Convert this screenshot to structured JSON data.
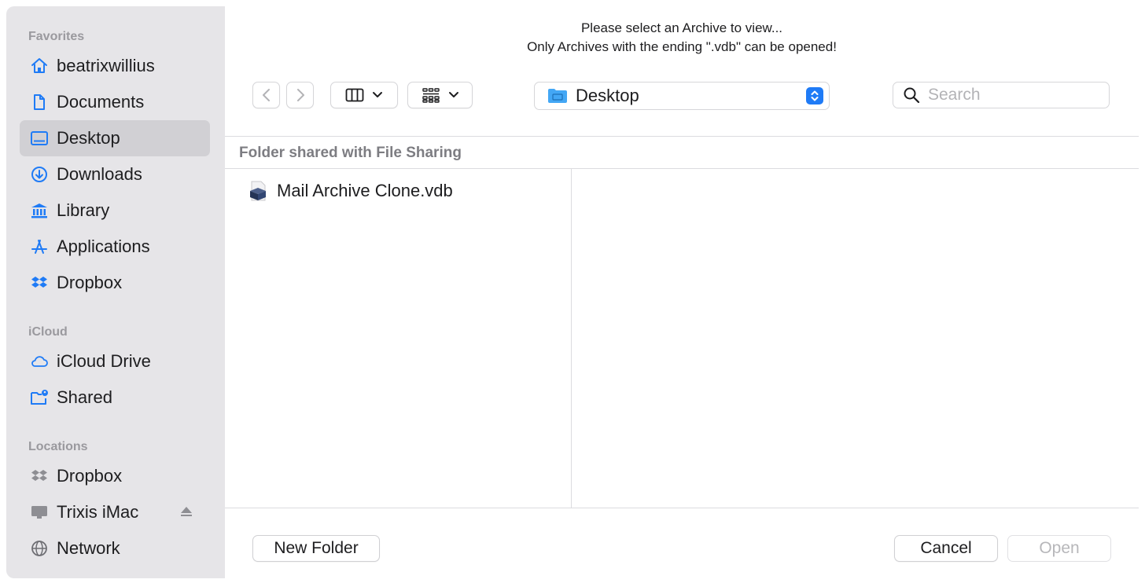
{
  "prompt": {
    "line1": "Please select an Archive to view...",
    "line2": "Only Archives with the ending \".vdb\" can be opened!"
  },
  "sidebar": {
    "favorites_label": "Favorites",
    "favorites": [
      {
        "label": "beatrixwillius",
        "icon": "home-icon"
      },
      {
        "label": "Documents",
        "icon": "document-icon"
      },
      {
        "label": "Desktop",
        "icon": "desktop-icon",
        "selected": true
      },
      {
        "label": "Downloads",
        "icon": "download-icon"
      },
      {
        "label": "Library",
        "icon": "library-icon"
      },
      {
        "label": "Applications",
        "icon": "applications-icon"
      },
      {
        "label": "Dropbox",
        "icon": "dropbox-icon"
      }
    ],
    "icloud_label": "iCloud",
    "icloud": [
      {
        "label": "iCloud Drive",
        "icon": "cloud-icon"
      },
      {
        "label": "Shared",
        "icon": "shared-folder-icon"
      }
    ],
    "locations_label": "Locations",
    "locations": [
      {
        "label": "Dropbox",
        "icon": "dropbox-icon"
      },
      {
        "label": "Trixis iMac",
        "icon": "imac-icon"
      },
      {
        "label": "Network",
        "icon": "network-icon"
      }
    ]
  },
  "toolbar": {
    "location": "Desktop",
    "search_placeholder": "Search"
  },
  "browser": {
    "group_header": "Folder shared with File Sharing",
    "files": [
      {
        "name": "Mail Archive Clone.vdb",
        "icon": "archive-file-icon"
      }
    ]
  },
  "buttons": {
    "new_folder": "New Folder",
    "cancel": "Cancel",
    "open": "Open"
  },
  "colors": {
    "accent": "#1f7bf6",
    "sidebar_bg": "#e6e5e8",
    "selected_bg": "#d1d0d4"
  }
}
